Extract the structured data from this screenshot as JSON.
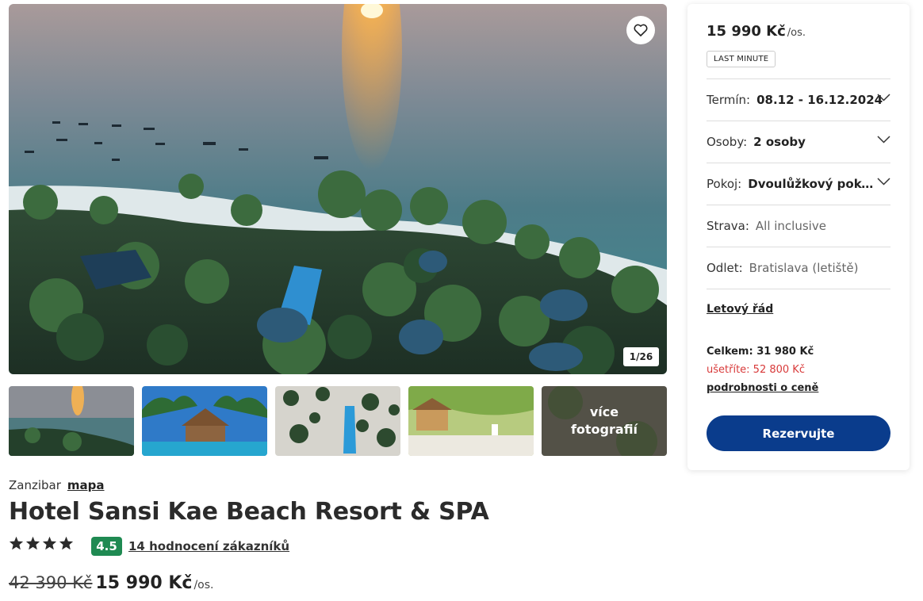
{
  "gallery": {
    "counter": "1/26",
    "more_label": "více fotografií"
  },
  "hotel": {
    "location": "Zanzibar",
    "map_link": "mapa",
    "name": "Hotel Sansi Kae Beach Resort & SPA",
    "stars": 4,
    "rating": "4.5",
    "reviews_link": "14 hodnocení zákazníků",
    "old_price": "42 390 Kč",
    "price": "15 990 Kč",
    "per_person": "/os."
  },
  "booking": {
    "price": "15 990 Kč",
    "per_person": "/os.",
    "badge": "LAST MINUTE",
    "term_label": "Termín:",
    "term_value": "08.12 - 16.12.2024",
    "persons_label": "Osoby:",
    "persons_value": "2 osoby",
    "room_label": "Pokoj:",
    "room_value": "Dvoulůžkový pokoj D...",
    "board_label": "Strava:",
    "board_value": "All inclusive",
    "departure_label": "Odlet:",
    "departure_value": "Bratislava (letiště)",
    "flight_link": "Letový řád",
    "total": "Celkem: 31 980 Kč",
    "save": "ušetříte: 52 800 Kč",
    "details_link": "podrobnosti o ceně",
    "reserve_button": "Rezervujte"
  },
  "colors": {
    "primary": "#0a3c8c",
    "rating": "#1f8a52",
    "saving": "#d83a3a"
  }
}
